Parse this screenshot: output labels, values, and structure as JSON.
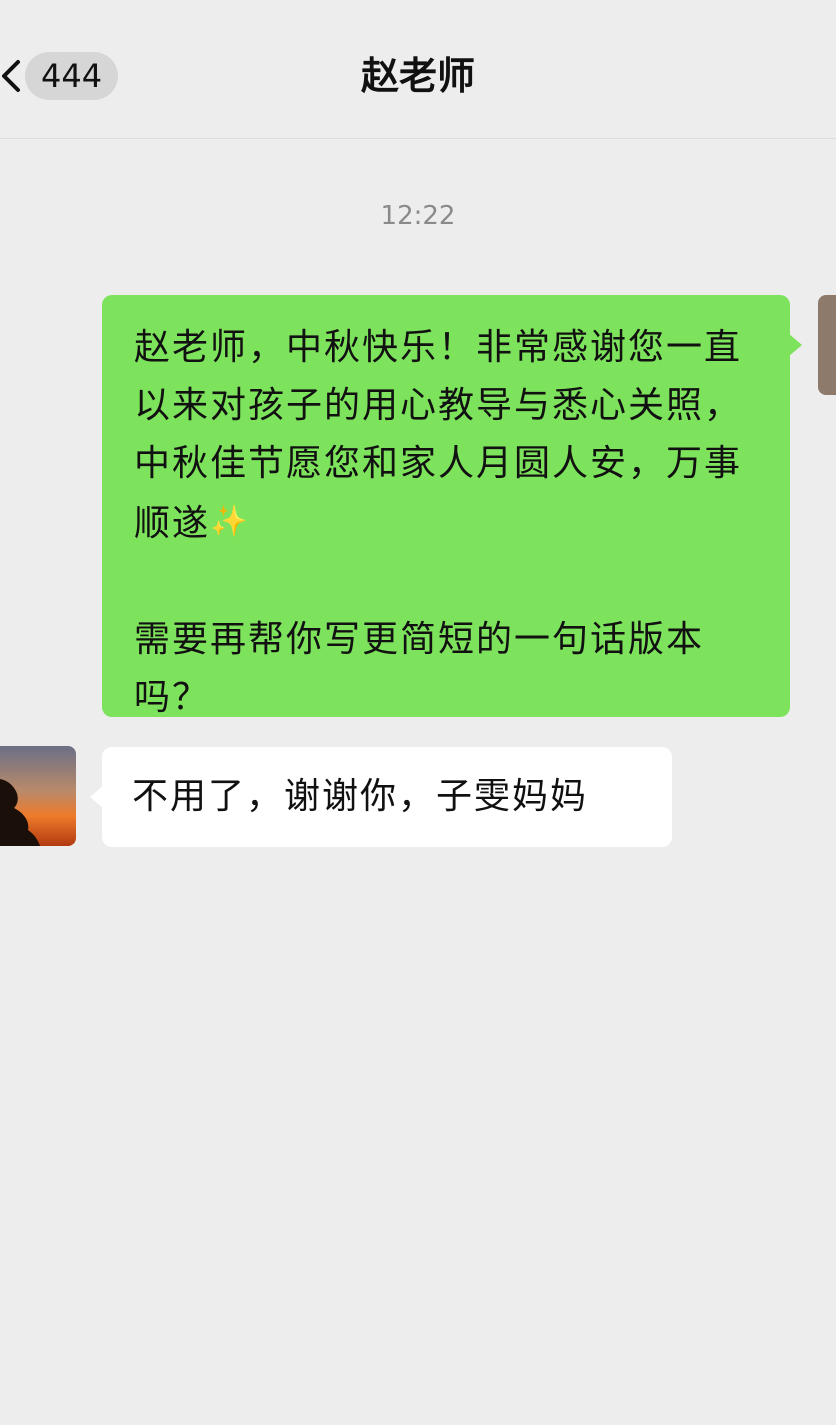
{
  "header": {
    "unread_count": "444",
    "title": "赵老师"
  },
  "icons": {
    "back": "chevron-left-icon",
    "sparkle": "sparkles-icon"
  },
  "chat": {
    "timestamp": "12:22",
    "messages": [
      {
        "direction": "sent",
        "text": "赵老师，中秋快乐！非常感谢您一直以来对孩子的用心教导与悉心关照，中秋佳节愿您和家人月圆人安，万事顺遂",
        "emoji": "✨",
        "text2": "需要再帮你写更简短的一句话版本吗？"
      },
      {
        "direction": "received",
        "text": "不用了，谢谢你，子雯妈妈"
      }
    ]
  },
  "colors": {
    "background": "#ededed",
    "sent_bubble": "#7ee35c",
    "received_bubble": "#ffffff",
    "badge": "#d6d6d6",
    "timestamp": "#8a8a8a"
  }
}
